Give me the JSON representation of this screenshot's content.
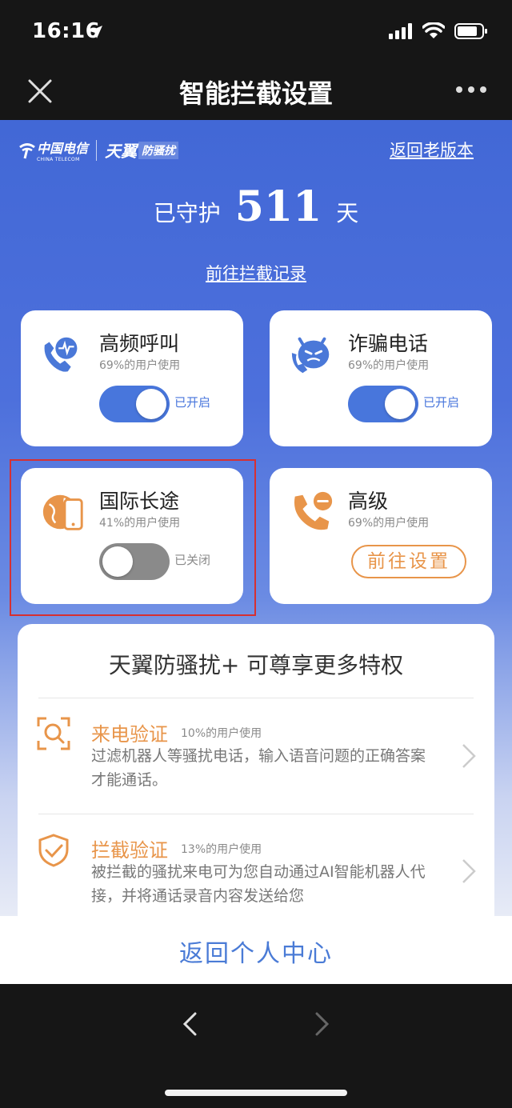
{
  "status": {
    "time": "16:16"
  },
  "nav": {
    "title": "智能拦截设置"
  },
  "brand": {
    "ct_cn": "中国电信",
    "ct_en": "CHINA TELECOM",
    "ty": "天翼",
    "fsr": "防骚扰"
  },
  "header": {
    "back_old_version": "返回老版本",
    "guard_prefix": "已守护",
    "guard_days": "511",
    "guard_suffix": "天",
    "record_link": "前往拦截记录"
  },
  "cards": [
    {
      "title": "高频呼叫",
      "usage": "69%的用户使用",
      "toggle": "on",
      "status": "已开启",
      "icon": "high-frequency-call-icon"
    },
    {
      "title": "诈骗电话",
      "usage": "69%的用户使用",
      "toggle": "on",
      "status": "已开启",
      "icon": "fraud-devil-icon"
    },
    {
      "title": "国际长途",
      "usage": "41%的用户使用",
      "toggle": "off",
      "status": "已关闭",
      "icon": "international-call-icon"
    },
    {
      "title": "高级",
      "usage": "69%的用户使用",
      "button": "前往设置",
      "icon": "advanced-phone-icon"
    }
  ],
  "perks": {
    "title": "天翼防骚扰+ 可尊享更多特权",
    "items": [
      {
        "title": "来电验证",
        "usage": "10%的用户使用",
        "desc": "过滤机器人等骚扰电话，输入语音问题的正确答案才能通话。",
        "icon": "scan-verify-icon"
      },
      {
        "title": "拦截验证",
        "usage": "13%的用户使用",
        "desc": "被拦截的骚扰来电可为您自动通过AI智能机器人代接，并将通话录音内容发送给您",
        "icon": "shield-check-icon"
      }
    ]
  },
  "footer": {
    "return_link": "返回个人中心"
  },
  "colors": {
    "accent_blue": "#4876dc",
    "accent_orange": "#e8954a",
    "highlight_red": "#d63032"
  }
}
